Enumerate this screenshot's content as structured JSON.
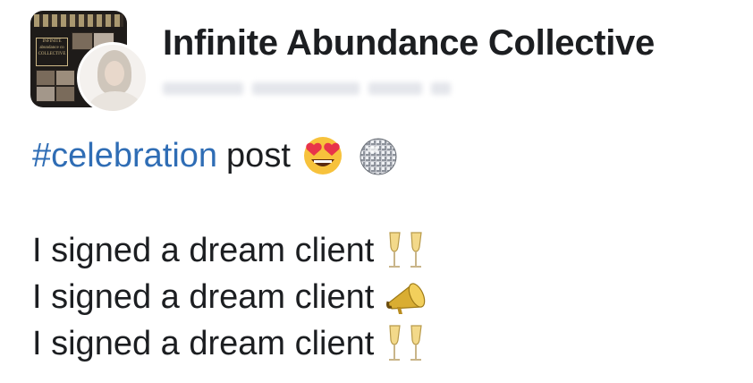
{
  "group": {
    "name": "Infinite Abundance Collective",
    "avatar_text": "INFINITE abundance co COLLECTIVE"
  },
  "post": {
    "hashtag": "#celebration",
    "tag_suffix": "post",
    "tag_emojis": [
      "heart-eyes-face-emoji",
      "mirror-ball-emoji"
    ],
    "lines": [
      {
        "text": "I signed a dream client",
        "emoji": "clinking-glasses-emoji"
      },
      {
        "text": "I signed a dream client",
        "emoji": "megaphone-emoji"
      },
      {
        "text": "I signed a dream client",
        "emoji": "clinking-glasses-emoji"
      }
    ]
  },
  "colors": {
    "hashtag": "#2f6db5",
    "text": "#1c1e21",
    "background": "#ffffff"
  }
}
